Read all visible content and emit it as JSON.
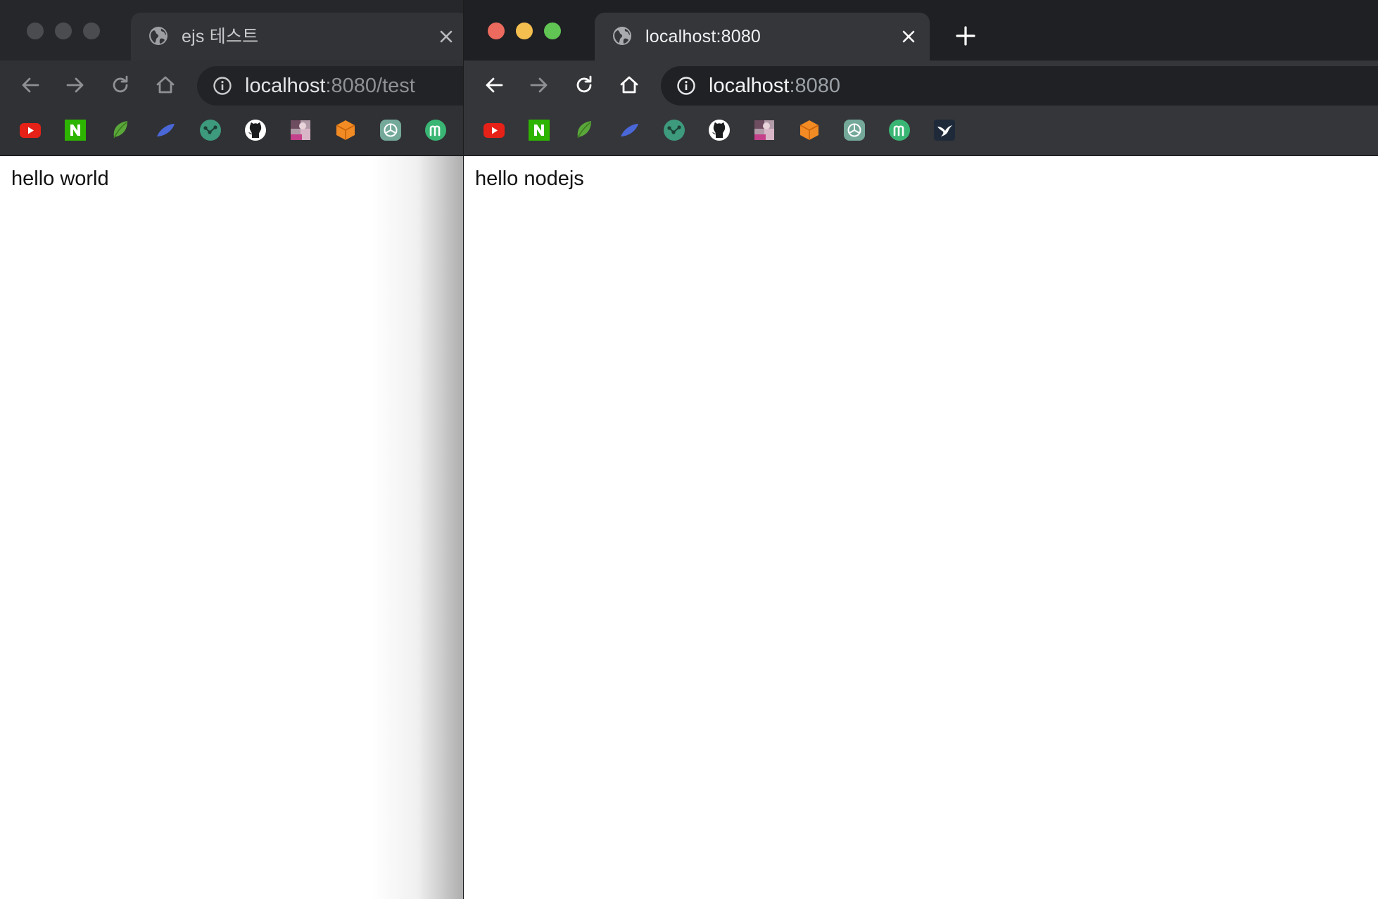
{
  "windows": [
    {
      "tab_title": "ejs 테스트",
      "url_host": "localhost",
      "url_rest": ":8080/test",
      "page_text": "hello world"
    },
    {
      "tab_title": "localhost:8080",
      "url_host": "localhost",
      "url_rest": ":8080",
      "page_text": "hello nodejs"
    }
  ],
  "bookmarks": [
    "youtube-icon",
    "naver-icon",
    "leaf-icon",
    "feather-icon",
    "gitgraph-icon",
    "github-icon",
    "photo-icon",
    "box-icon",
    "chatgpt-icon",
    "m-icon",
    "bird-icon"
  ],
  "colors": {
    "traffic_red": "#ed6a5e",
    "traffic_yellow": "#f5bf4f",
    "traffic_green": "#61c554",
    "inactive_light": "#4b4c4f"
  }
}
